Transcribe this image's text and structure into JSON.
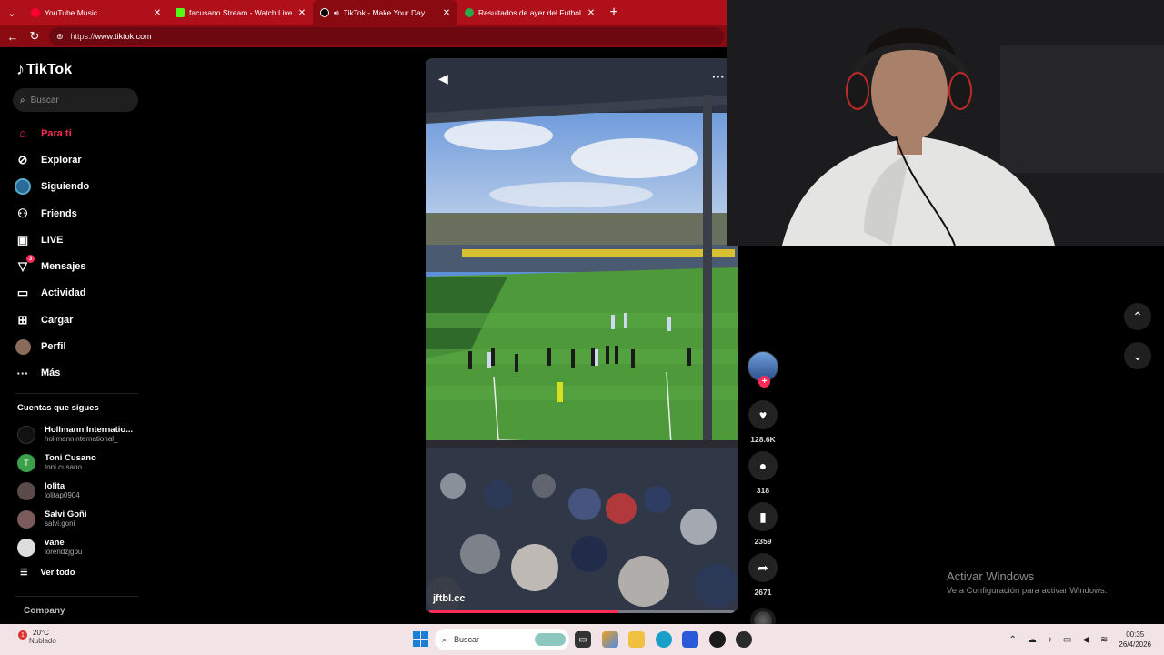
{
  "browser": {
    "tabs": [
      {
        "title": "YouTube Music",
        "color": "#ff0033"
      },
      {
        "title": "facusano Stream - Watch Live on K",
        "color": "#53fc18"
      },
      {
        "title": "TikTok - Make Your Day",
        "color": "#000000"
      },
      {
        "title": "Resultados de ayer del Futbol Arg",
        "color": "#2ba84a"
      }
    ],
    "url_scheme": "https://",
    "url_host": "www.tiktok.com"
  },
  "sidebar": {
    "logo": "TikTok",
    "search_placeholder": "Buscar",
    "nav": [
      {
        "label": "Para ti",
        "icon": "home-icon"
      },
      {
        "label": "Explorar",
        "icon": "compass-icon"
      },
      {
        "label": "Siguiendo",
        "icon": "following-icon"
      },
      {
        "label": "Friends",
        "icon": "friends-icon"
      },
      {
        "label": "LIVE",
        "icon": "live-icon"
      },
      {
        "label": "Mensajes",
        "icon": "messages-icon",
        "badge": "3"
      },
      {
        "label": "Actividad",
        "icon": "activity-icon"
      },
      {
        "label": "Cargar",
        "icon": "upload-icon"
      },
      {
        "label": "Perfil",
        "icon": "profile-icon"
      },
      {
        "label": "Más",
        "icon": "more-icon"
      }
    ],
    "following_title": "Cuentas que sigues",
    "following": [
      {
        "name": "Hollmann Internatio...",
        "user": "hollmanninternational_"
      },
      {
        "name": "Toni Cusano",
        "user": "toni.cusano"
      },
      {
        "name": "lolita",
        "user": "lolitap0904"
      },
      {
        "name": "Salvi Goñi",
        "user": "salvi.goni"
      },
      {
        "name": "vane",
        "user": "lorendzjgpu"
      }
    ],
    "see_all": "Ver todo",
    "company": "Company"
  },
  "video": {
    "watermark": "jftbl.cc",
    "progress": 0.62
  },
  "actions": {
    "likes": "128.6K",
    "comments": "318",
    "saves": "2359",
    "shares": "2671"
  },
  "activate_windows": {
    "title": "Activar Windows",
    "subtitle": "Ve a Configuración para activar Windows."
  },
  "taskbar": {
    "temp": "20°C",
    "condition": "Nublado",
    "search": "Buscar",
    "time": "00:35",
    "date": "26/4/2026"
  }
}
